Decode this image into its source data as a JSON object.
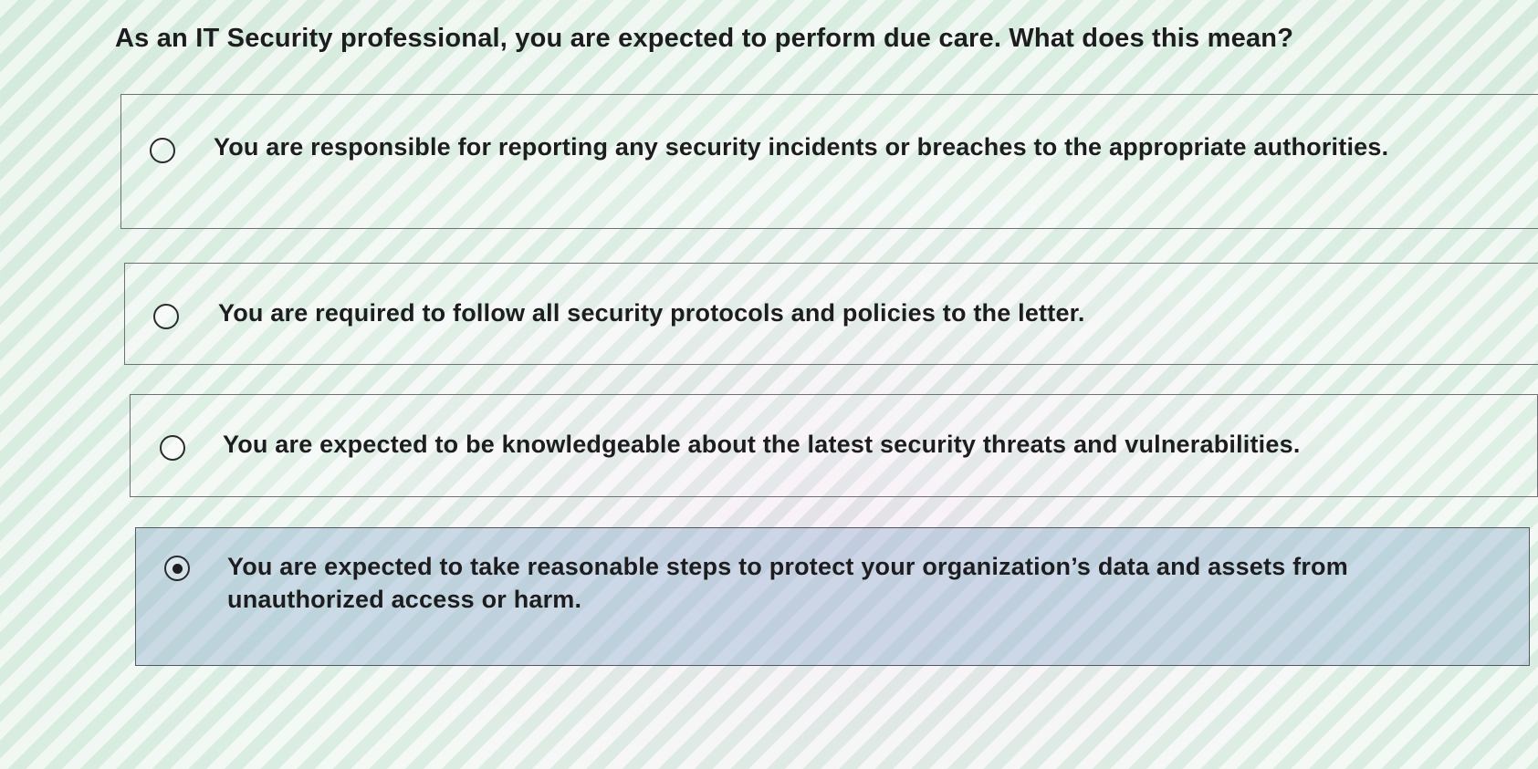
{
  "question": {
    "text": "As an IT Security professional, you are expected to perform due care. What does this mean?"
  },
  "options": [
    {
      "label": "You are responsible for reporting any security incidents or breaches to the appropriate authorities.",
      "selected": false
    },
    {
      "label": "You are required to follow all security protocols and policies to the letter.",
      "selected": false
    },
    {
      "label": "You are expected to be knowledgeable about the latest security threats and vulnerabilities.",
      "selected": false
    },
    {
      "label": "You are expected to take reasonable steps to protect your organization’s data and assets from unauthorized access or harm.",
      "selected": true
    }
  ],
  "colors": {
    "selected_background": "#a6bfd6",
    "border": "#6f6f74",
    "text": "#1d1d1f"
  }
}
